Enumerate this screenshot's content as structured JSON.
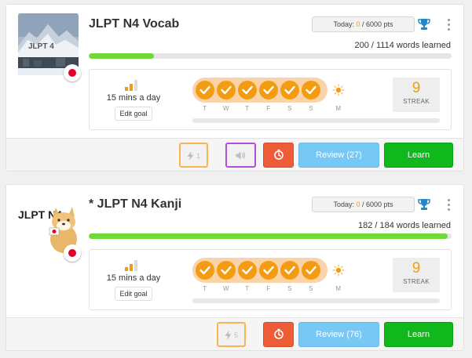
{
  "courses": [
    {
      "title": "JLPT N4 Vocab",
      "thumbnail_text": "JLPT 4",
      "points": {
        "label": "Today:",
        "current": "0",
        "total": "/ 6000 pts"
      },
      "progress_fraction": 0.1795,
      "words_learned": "200 / 1114 words learned",
      "goal": {
        "text": "15 mins a day",
        "edit_label": "Edit goal"
      },
      "days": [
        "T",
        "W",
        "T",
        "F",
        "S",
        "S",
        "M"
      ],
      "days_completed": 6,
      "streak": {
        "value": "9",
        "label": "STREAK"
      },
      "buttons": {
        "speed_count": "1",
        "review": "Review (27)",
        "learn": "Learn"
      }
    },
    {
      "title": "* JLPT N4 Kanji",
      "thumbnail_text": "JLPT N4",
      "points": {
        "label": "Today:",
        "current": "0",
        "total": "/ 6000 pts"
      },
      "progress_fraction": 0.9891,
      "words_learned": "182 / 184 words learned",
      "goal": {
        "text": "15 mins a day",
        "edit_label": "Edit goal"
      },
      "days": [
        "T",
        "W",
        "T",
        "F",
        "S",
        "S",
        "M"
      ],
      "days_completed": 6,
      "streak": {
        "value": "9",
        "label": "STREAK"
      },
      "buttons": {
        "speed_count": "5",
        "review": "Review (76)",
        "learn": "Learn"
      }
    }
  ],
  "colors": {
    "accent_orange": "#f39c12",
    "progress_green": "#6fd93a",
    "learn_green": "#10b81c",
    "review_blue": "#78c8f6",
    "timer_red": "#ee5b37",
    "audio_purple": "#b34fd6",
    "trophy_blue": "#1e88c9",
    "flag_red": "#e4002b"
  },
  "icons": {
    "trophy": "trophy-icon",
    "menu": "kebab-menu-icon",
    "signal": "signal-bars-icon",
    "day_done": "checkmark-icon",
    "today": "sun-icon",
    "speed": "lightning-icon",
    "audio": "speaker-icon",
    "timer": "stopwatch-icon",
    "flag": "japan-flag-icon"
  }
}
